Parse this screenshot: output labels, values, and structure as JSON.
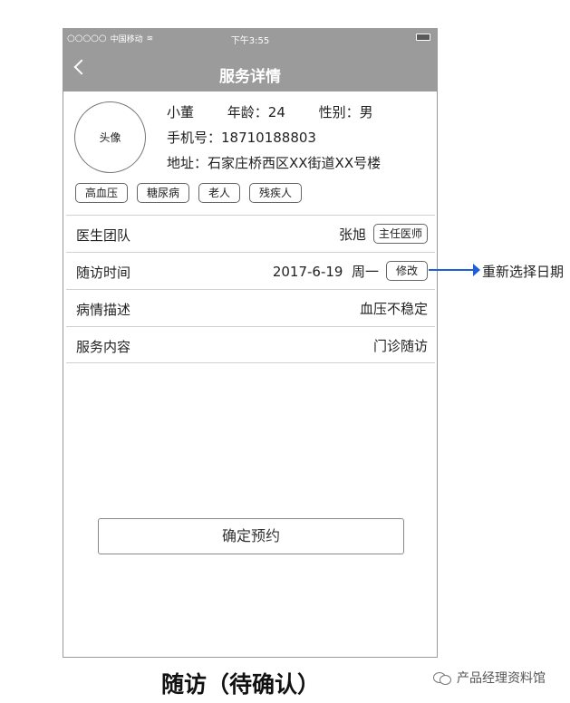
{
  "status_bar": {
    "signal": "○○○○○",
    "carrier": "中国移动",
    "wifi_icon": "wifi-icon",
    "time": "下午3:55",
    "battery_icon": "battery-icon"
  },
  "header": {
    "back_icon": "chevron-left-icon",
    "title": "服务详情"
  },
  "profile": {
    "avatar_label": "头像",
    "name": "小董",
    "age": "年龄：24",
    "gender": "性别：男",
    "phone": "手机号：18710188803",
    "address": "地址：石家庄桥西区XX街道XX号楼",
    "tags": [
      "高血压",
      "糖尿病",
      "老人",
      "残疾人"
    ]
  },
  "rows": {
    "team": {
      "label": "医生团队",
      "value": "张旭",
      "badge": "主任医师"
    },
    "visit_time": {
      "label": "随访时间",
      "value": "2017-6-19  周一",
      "button": "修改"
    },
    "condition": {
      "label": "病情描述",
      "value": "血压不稳定"
    },
    "service": {
      "label": "服务内容",
      "value": "门诊随访"
    }
  },
  "confirm_button": "确定预约",
  "annotation": {
    "text": "重新选择日期",
    "color": "#1d5fd6"
  },
  "caption": "随访（待确认）",
  "watermark": "产品经理资料馆",
  "colors": {
    "header_bg": "#9b9b9b"
  }
}
